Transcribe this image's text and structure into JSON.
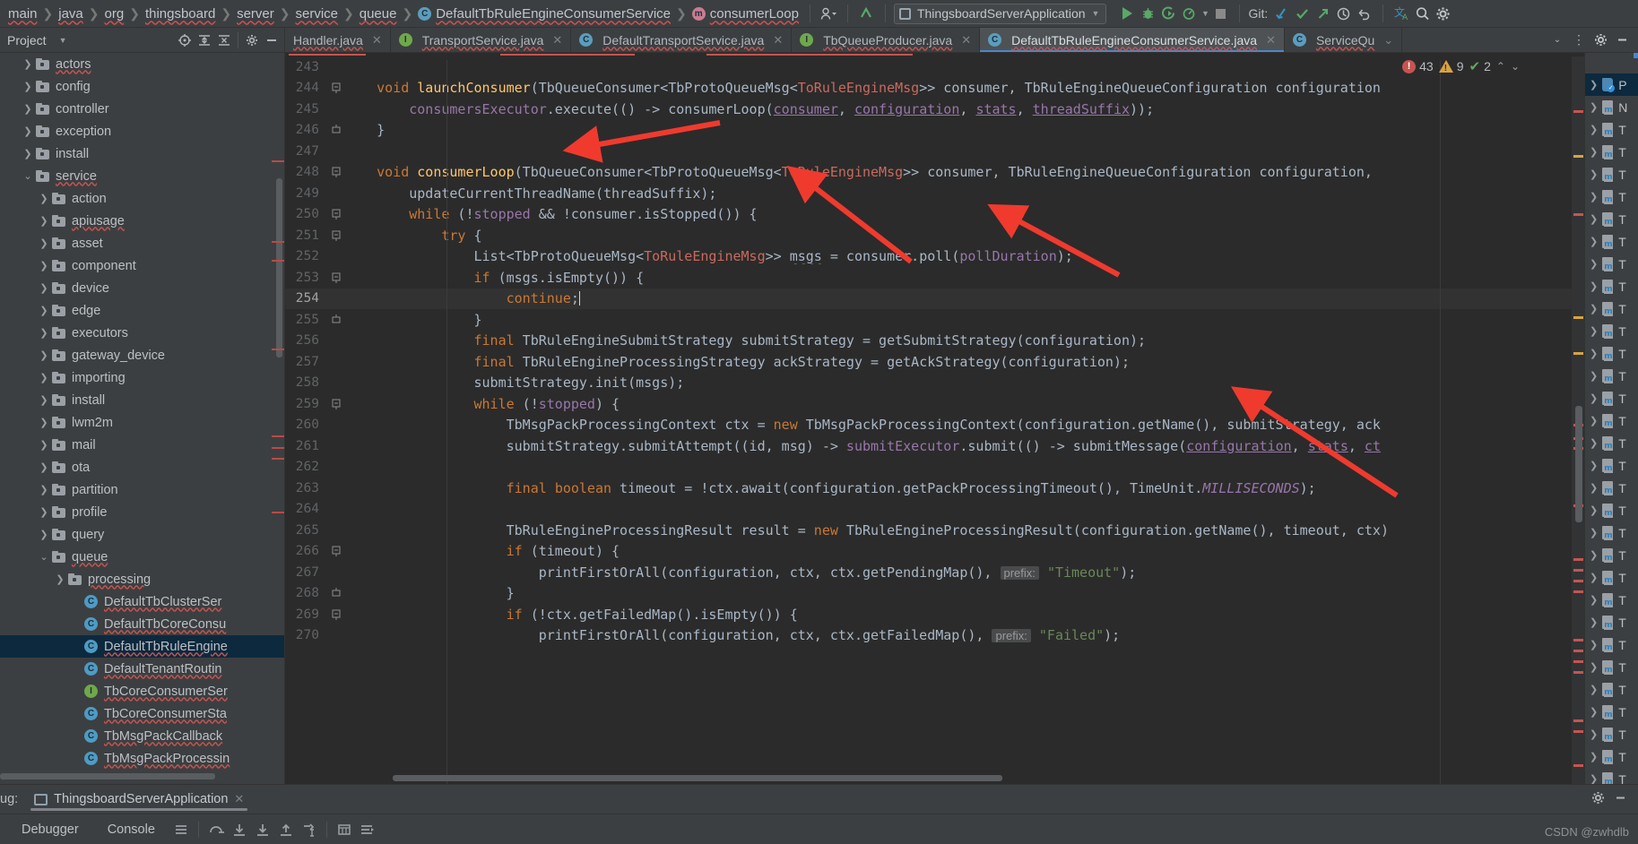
{
  "toolbar": {
    "breadcrumbs": [
      {
        "label": "main",
        "icon": null
      },
      {
        "label": "java",
        "icon": null
      },
      {
        "label": "org",
        "icon": null
      },
      {
        "label": "thingsboard",
        "icon": null
      },
      {
        "label": "server",
        "icon": null
      },
      {
        "label": "service",
        "icon": null
      },
      {
        "label": "queue",
        "icon": null
      },
      {
        "label": "DefaultTbRuleEngineConsumerService",
        "icon": "class-icon"
      },
      {
        "label": "consumerLoop",
        "icon": "method-icon"
      }
    ],
    "profile_icon": "user-profile-icon",
    "update_icon": "vcs-update-icon",
    "run_config": "ThingsboardServerApplication",
    "run_icon": "run-icon",
    "debug_icon": "debug-icon",
    "coverage_icon": "run-with-coverage-icon",
    "profiler_icon": "profiler-icon",
    "stop_icon": "stop-icon",
    "git_label": "Git:",
    "git_pull_icon": "git-pull-icon",
    "git_commit_icon": "git-commit-icon",
    "git_push_icon": "git-push-icon",
    "history_icon": "history-icon",
    "rollback_icon": "rollback-icon",
    "translate_icon": "translate-icon",
    "search_icon": "search-icon",
    "settings_icon": "gear-icon"
  },
  "project_panel": {
    "title": "Project",
    "chevron": "chevron-down-icon",
    "icons": [
      "locate-icon",
      "expand-all-icon",
      "collapse-all-icon",
      "gear-icon",
      "hide-icon"
    ],
    "tree": [
      {
        "label": "actors",
        "type": "folder",
        "indent": 2,
        "arrow": "right",
        "squiggle": true
      },
      {
        "label": "config",
        "type": "folder",
        "indent": 2,
        "arrow": "right",
        "squiggle": false
      },
      {
        "label": "controller",
        "type": "folder",
        "indent": 2,
        "arrow": "right",
        "squiggle": false
      },
      {
        "label": "exception",
        "type": "folder",
        "indent": 2,
        "arrow": "right",
        "squiggle": false
      },
      {
        "label": "install",
        "type": "folder",
        "indent": 2,
        "arrow": "right",
        "squiggle": false
      },
      {
        "label": "service",
        "type": "folder",
        "indent": 2,
        "arrow": "down",
        "squiggle": true
      },
      {
        "label": "action",
        "type": "folder",
        "indent": 3,
        "arrow": "right",
        "squiggle": false
      },
      {
        "label": "apiusage",
        "type": "folder",
        "indent": 3,
        "arrow": "right",
        "squiggle": true
      },
      {
        "label": "asset",
        "type": "folder",
        "indent": 3,
        "arrow": "right",
        "squiggle": false
      },
      {
        "label": "component",
        "type": "folder",
        "indent": 3,
        "arrow": "right",
        "squiggle": false
      },
      {
        "label": "device",
        "type": "folder",
        "indent": 3,
        "arrow": "right",
        "squiggle": false
      },
      {
        "label": "edge",
        "type": "folder",
        "indent": 3,
        "arrow": "right",
        "squiggle": false
      },
      {
        "label": "executors",
        "type": "folder",
        "indent": 3,
        "arrow": "right",
        "squiggle": false
      },
      {
        "label": "gateway_device",
        "type": "folder",
        "indent": 3,
        "arrow": "right",
        "squiggle": false
      },
      {
        "label": "importing",
        "type": "folder",
        "indent": 3,
        "arrow": "right",
        "squiggle": false
      },
      {
        "label": "install",
        "type": "folder",
        "indent": 3,
        "arrow": "right",
        "squiggle": false
      },
      {
        "label": "lwm2m",
        "type": "folder",
        "indent": 3,
        "arrow": "right",
        "squiggle": false
      },
      {
        "label": "mail",
        "type": "folder",
        "indent": 3,
        "arrow": "right",
        "squiggle": false
      },
      {
        "label": "ota",
        "type": "folder",
        "indent": 3,
        "arrow": "right",
        "squiggle": false
      },
      {
        "label": "partition",
        "type": "folder",
        "indent": 3,
        "arrow": "right",
        "squiggle": false
      },
      {
        "label": "profile",
        "type": "folder",
        "indent": 3,
        "arrow": "right",
        "squiggle": false
      },
      {
        "label": "query",
        "type": "folder",
        "indent": 3,
        "arrow": "right",
        "squiggle": false
      },
      {
        "label": "queue",
        "type": "folder",
        "indent": 3,
        "arrow": "down",
        "squiggle": true
      },
      {
        "label": "processing",
        "type": "folder",
        "indent": 4,
        "arrow": "right",
        "squiggle": true
      },
      {
        "label": "DefaultTbClusterSer",
        "type": "class",
        "indent": 5,
        "arrow": null,
        "squiggle": true
      },
      {
        "label": "DefaultTbCoreConsu",
        "type": "class",
        "indent": 5,
        "arrow": null,
        "squiggle": true
      },
      {
        "label": "DefaultTbRuleEngine",
        "type": "class",
        "indent": 5,
        "arrow": null,
        "squiggle": true,
        "selected": true
      },
      {
        "label": "DefaultTenantRoutin",
        "type": "class",
        "indent": 5,
        "arrow": null,
        "squiggle": true
      },
      {
        "label": "TbCoreConsumerSer",
        "type": "interface",
        "indent": 5,
        "arrow": null,
        "squiggle": true
      },
      {
        "label": "TbCoreConsumerSta",
        "type": "class",
        "indent": 5,
        "arrow": null,
        "squiggle": true
      },
      {
        "label": "TbMsgPackCallback",
        "type": "class",
        "indent": 5,
        "arrow": null,
        "squiggle": true
      },
      {
        "label": "TbMsgPackProcessin",
        "type": "class",
        "indent": 5,
        "arrow": null,
        "squiggle": true
      }
    ]
  },
  "tabs": [
    {
      "label": "Handler.java",
      "icon": null,
      "active": false,
      "closable": true
    },
    {
      "label": "TransportService.java",
      "icon": "interface-icon",
      "active": false,
      "closable": true
    },
    {
      "label": "DefaultTransportService.java",
      "icon": "class-icon",
      "active": false,
      "closable": true
    },
    {
      "label": "TbQueueProducer.java",
      "icon": "interface-icon",
      "active": false,
      "closable": true
    },
    {
      "label": "DefaultTbRuleEngineConsumerService.java",
      "icon": "class-icon",
      "active": true,
      "closable": true
    },
    {
      "label": "ServiceQu",
      "icon": "class-icon",
      "active": false,
      "closable": false
    }
  ],
  "tab_end_icons": [
    "chevron-down-icon",
    "more-vertical-icon",
    "gear-icon",
    "hide-icon"
  ],
  "inspections": {
    "errors": "43",
    "warnings": "9",
    "checks": "2",
    "up_icon": "chevron-up-icon",
    "down_icon": "chevron-down-icon"
  },
  "editor": {
    "lines": [
      {
        "n": "243",
        "fold": null,
        "html": ""
      },
      {
        "n": "244",
        "fold": "open",
        "html": "    <span class='kw'>void</span> <span class='fn'>launchConsumer</span>(TbQueueConsumer&lt;TbProtoQueueMsg&lt;<span class='red'>ToRuleEngineMsg</span>&gt;&gt; consumer, TbRuleEngineQueueConfiguration configuration"
      },
      {
        "n": "245",
        "fold": null,
        "html": "        <span class='pur'>consumersExecutor</span>.execute(() -&gt; consumerLoop(<span class='fieldu'>consumer</span>, <span class='fieldu'>configuration</span>, <span class='fieldu'>stats</span>, <span class='fieldu'>threadSuffix</span>));"
      },
      {
        "n": "246",
        "fold": "close",
        "html": "    }"
      },
      {
        "n": "247",
        "fold": null,
        "html": ""
      },
      {
        "n": "248",
        "fold": "open",
        "html": "    <span class='kw'>void</span> <span class='fn'>consumerLoop</span>(TbQueueConsumer&lt;TbProtoQueueMsg&lt;<span class='red'>ToRuleEngineMsg</span>&gt;&gt; consumer, TbRuleEngineQueueConfiguration configuration, "
      },
      {
        "n": "249",
        "fold": null,
        "html": "        updateCurrentThreadName(threadSuffix);"
      },
      {
        "n": "250",
        "fold": "open",
        "html": "        <span class='kw'>while</span> (!<span class='pur'>stopped</span> &amp;&amp; !consumer.isStopped()) {"
      },
      {
        "n": "251",
        "fold": "open",
        "html": "            <span class='kw'>try</span> {"
      },
      {
        "n": "252",
        "fold": null,
        "html": "                List&lt;TbProtoQueueMsg&lt;<span class='red'>ToRuleEngineMsg</span>&gt;&gt; <span class='greenw'>msgs</span> = consumer.poll(<span class='pur'>pollDuration</span>);"
      },
      {
        "n": "253",
        "fold": "open",
        "html": "                <span class='kw'>if</span> (msgs.isEmpty()) {"
      },
      {
        "n": "254",
        "fold": null,
        "current": true,
        "html": "                    <span class='kw'>continue</span>;<span class='caret'></span>"
      },
      {
        "n": "255",
        "fold": "close",
        "html": "                }"
      },
      {
        "n": "256",
        "fold": null,
        "html": "                <span class='kw'>final</span> TbRuleEngineSubmitStrategy submitStrategy = getSubmitStrategy(configuration);"
      },
      {
        "n": "257",
        "fold": null,
        "html": "                <span class='kw'>final</span> TbRuleEngineProcessingStrategy ackStrategy = getAckStrategy(configuration);"
      },
      {
        "n": "258",
        "fold": null,
        "html": "                submitStrategy.init(msgs);"
      },
      {
        "n": "259",
        "fold": "open",
        "html": "                <span class='kw'>while</span> (!<span class='pur'>stopped</span>) {"
      },
      {
        "n": "260",
        "fold": null,
        "html": "                    TbMsgPackProcessingContext ctx = <span class='kw'>new</span> TbMsgPackProcessingContext(configuration.getName(), submitStrategy, ack"
      },
      {
        "n": "261",
        "fold": null,
        "html": "                    submitStrategy.submitAttempt((id, msg) -&gt; <span class='pur'>submitExecutor</span>.submit(() -&gt; submitMessage(<span class='fieldu'>configuration</span>, <span class='fieldu'>stats</span>, <span class='fieldu'>ct</span>"
      },
      {
        "n": "262",
        "fold": null,
        "html": ""
      },
      {
        "n": "263",
        "fold": null,
        "html": "                    <span class='kw'>final</span> <span class='kw'>boolean</span> timeout = !ctx.await(configuration.getPackProcessingTimeout(), TimeUnit.<span class='pur'><i>MILLISECONDS</i></span>);"
      },
      {
        "n": "264",
        "fold": null,
        "html": ""
      },
      {
        "n": "265",
        "fold": null,
        "html": "                    TbRuleEngineProcessingResult result = <span class='kw'>new</span> TbRuleEngineProcessingResult(configuration.getName(), timeout, ctx)"
      },
      {
        "n": "266",
        "fold": "open",
        "html": "                    <span class='kw'>if</span> (timeout) {"
      },
      {
        "n": "267",
        "fold": null,
        "html": "                        printFirstOrAll(configuration, ctx, ctx.getPendingMap(), <span class='hint'>prefix:</span> <span class='str'>\"Timeout\"</span>);"
      },
      {
        "n": "268",
        "fold": "close",
        "html": "                    }"
      },
      {
        "n": "269",
        "fold": "open",
        "html": "                    <span class='kw'>if</span> (!ctx.getFailedMap().isEmpty()) {"
      },
      {
        "n": "270",
        "fold": null,
        "html": "                        printFirstOrAll(configuration, ctx, ctx.getFailedMap(), <span class='hint'>prefix:</span> <span class='str'>\"Failed\"</span>);"
      }
    ]
  },
  "right_panel": {
    "rows": [
      {
        "icon": "folder-check-icon",
        "label": "P"
      },
      {
        "icon": "maven-module-icon",
        "label": "N"
      },
      {
        "icon": "maven-module-icon",
        "label": "T"
      },
      {
        "icon": "maven-module-icon",
        "label": "T"
      },
      {
        "icon": "maven-module-icon",
        "label": "T"
      },
      {
        "icon": "maven-module-icon",
        "label": "T"
      },
      {
        "icon": "maven-module-icon",
        "label": "T"
      },
      {
        "icon": "maven-module-icon",
        "label": "T"
      },
      {
        "icon": "maven-module-icon",
        "label": "T"
      },
      {
        "icon": "maven-module-icon",
        "label": "T"
      },
      {
        "icon": "maven-module-icon",
        "label": "T"
      },
      {
        "icon": "maven-module-icon",
        "label": "T"
      },
      {
        "icon": "maven-module-icon",
        "label": "T"
      },
      {
        "icon": "maven-module-icon",
        "label": "T"
      },
      {
        "icon": "maven-module-icon",
        "label": "T"
      },
      {
        "icon": "maven-module-icon",
        "label": "T"
      },
      {
        "icon": "maven-module-icon",
        "label": "T"
      },
      {
        "icon": "maven-module-icon",
        "label": "T"
      },
      {
        "icon": "maven-module-icon",
        "label": "T"
      },
      {
        "icon": "maven-module-icon",
        "label": "T"
      },
      {
        "icon": "maven-module-icon",
        "label": "T"
      },
      {
        "icon": "maven-module-icon",
        "label": "T"
      },
      {
        "icon": "maven-module-icon",
        "label": "T"
      },
      {
        "icon": "maven-module-icon",
        "label": "T"
      },
      {
        "icon": "maven-module-icon",
        "label": "T"
      },
      {
        "icon": "maven-module-icon",
        "label": "T"
      },
      {
        "icon": "maven-module-icon",
        "label": "T"
      },
      {
        "icon": "maven-module-icon",
        "label": "T"
      },
      {
        "icon": "maven-module-icon",
        "label": "T"
      },
      {
        "icon": "maven-module-icon",
        "label": "T"
      },
      {
        "icon": "maven-module-icon",
        "label": "T"
      },
      {
        "icon": "maven-module-icon",
        "label": "T"
      }
    ],
    "refresh_icon": "refresh-icon",
    "expand_icon": "expand-right-icon"
  },
  "debug_panel": {
    "label": "ug:",
    "session": "ThingsboardServerApplication",
    "close_icon": "close-icon",
    "settings_icon": "gear-icon",
    "hide_icon": "hide-icon"
  },
  "status_bar": {
    "buttons": [
      "Debugger",
      "Console"
    ],
    "icons": [
      "menu-icon",
      "step-over-icon",
      "step-into-icon",
      "force-step-into-icon",
      "step-out-icon",
      "run-to-cursor-icon",
      "evaluate-icon",
      "threads-icon"
    ]
  },
  "watermark": "CSDN @zwhdlb",
  "colors": {
    "accent": "#4a88c7",
    "error": "#c75450",
    "warning": "#d9a343",
    "ok": "#59a869",
    "editor_bg": "#2b2b2b",
    "panel_bg": "#3c3f41",
    "selection": "#0d293e",
    "annotation_arrow": "#f03a2e"
  }
}
